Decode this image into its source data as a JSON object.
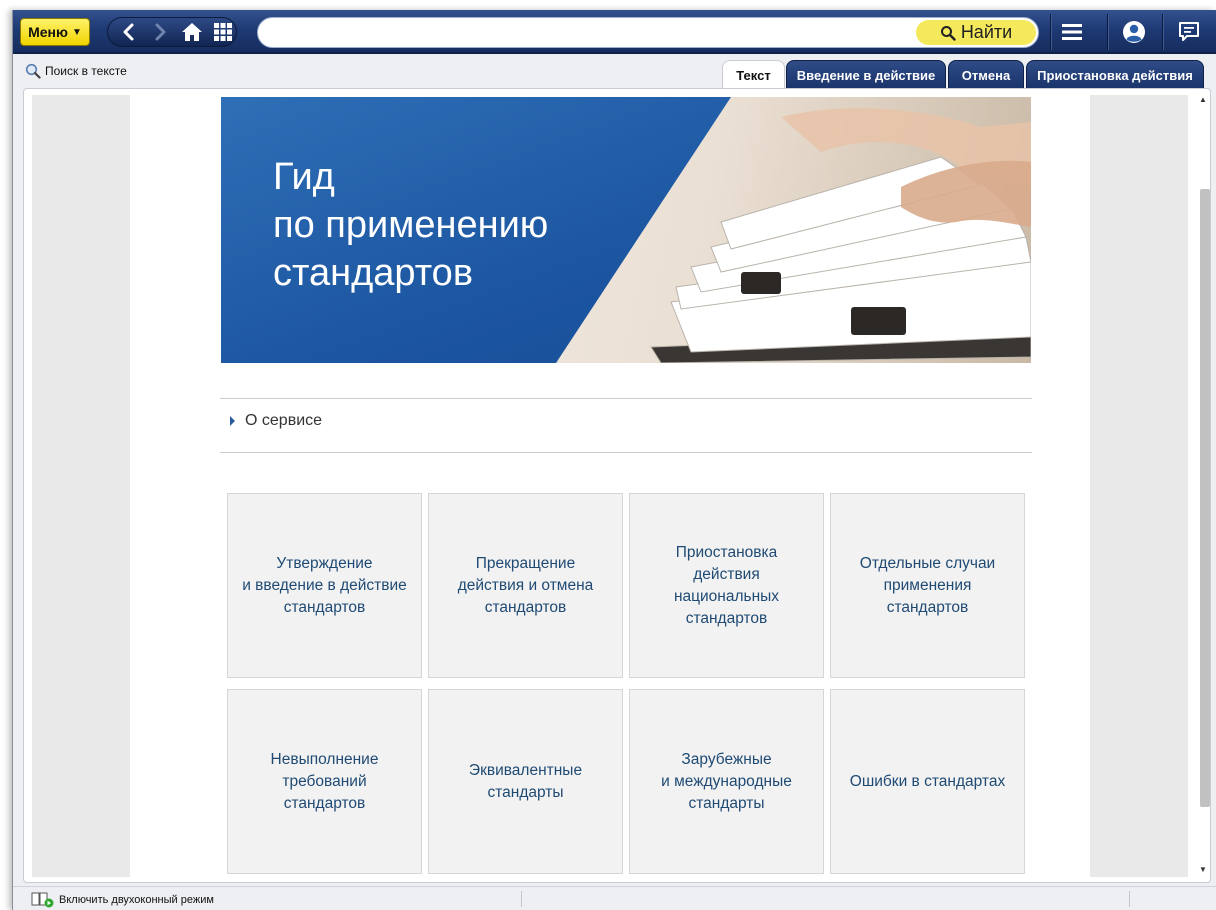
{
  "topbar": {
    "menu_label": "Меню",
    "find_label": "Найти",
    "search_value": ""
  },
  "toolbar": {
    "search_in_text": "Поиск в тексте",
    "tabs": [
      {
        "label": "Текст",
        "active": true
      },
      {
        "label": "Введение в действие",
        "active": false
      },
      {
        "label": "Отмена",
        "active": false
      },
      {
        "label": "Приостановка действия",
        "active": false
      }
    ]
  },
  "banner": {
    "title_lines": [
      "Гид",
      "по применению",
      "стандартов"
    ]
  },
  "about": {
    "label": "О сервисе"
  },
  "cards": [
    {
      "label": "Утверждение\nи введение в действие\nстандартов"
    },
    {
      "label": "Прекращение\nдействия и отмена\nстандартов"
    },
    {
      "label": "Приостановка\nдействия\nнациональных\nстандартов"
    },
    {
      "label": "Отдельные случаи\nприменения\nстандартов"
    },
    {
      "label": "Невыполнение\nтребований\nстандартов"
    },
    {
      "label": "Эквивалентные\nстандарты"
    },
    {
      "label": "Зарубежные\nи международные\nстандарты"
    },
    {
      "label": "Ошибки в стандартах"
    }
  ],
  "statusbar": {
    "dual_mode_label": "Включить двухоконный режим"
  },
  "colors": {
    "topbar": "#1f3a74",
    "menu_button": "#f0d400",
    "find_button": "#f4e95a",
    "banner_blue": "#1c55a0",
    "card_text": "#1f4a73",
    "card_bg": "#f2f2f2"
  }
}
